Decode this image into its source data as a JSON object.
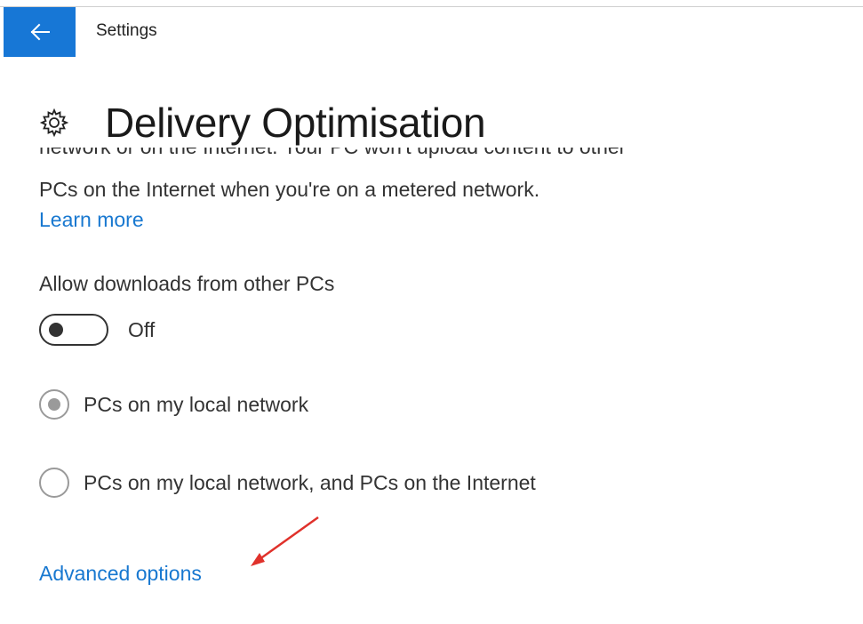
{
  "window": {
    "title": "Settings"
  },
  "header": {
    "title": "Delivery Optimisation",
    "icon": "gear-icon"
  },
  "content": {
    "cut_off_line": "network or on the Internet. Your PC won't upload content to other",
    "description": "PCs on the Internet when you're on a metered network.",
    "learn_more": "Learn more",
    "allow_label": "Allow downloads from other PCs",
    "toggle": {
      "state": "Off",
      "on": false
    },
    "radio_options": [
      {
        "label": "PCs on my local network",
        "selected": true
      },
      {
        "label": "PCs on my local network, and PCs on the Internet",
        "selected": false
      }
    ],
    "advanced_options": "Advanced options"
  },
  "colors": {
    "accent": "#1777d6",
    "link": "#1878d0",
    "annotation_arrow": "#e0312b"
  }
}
